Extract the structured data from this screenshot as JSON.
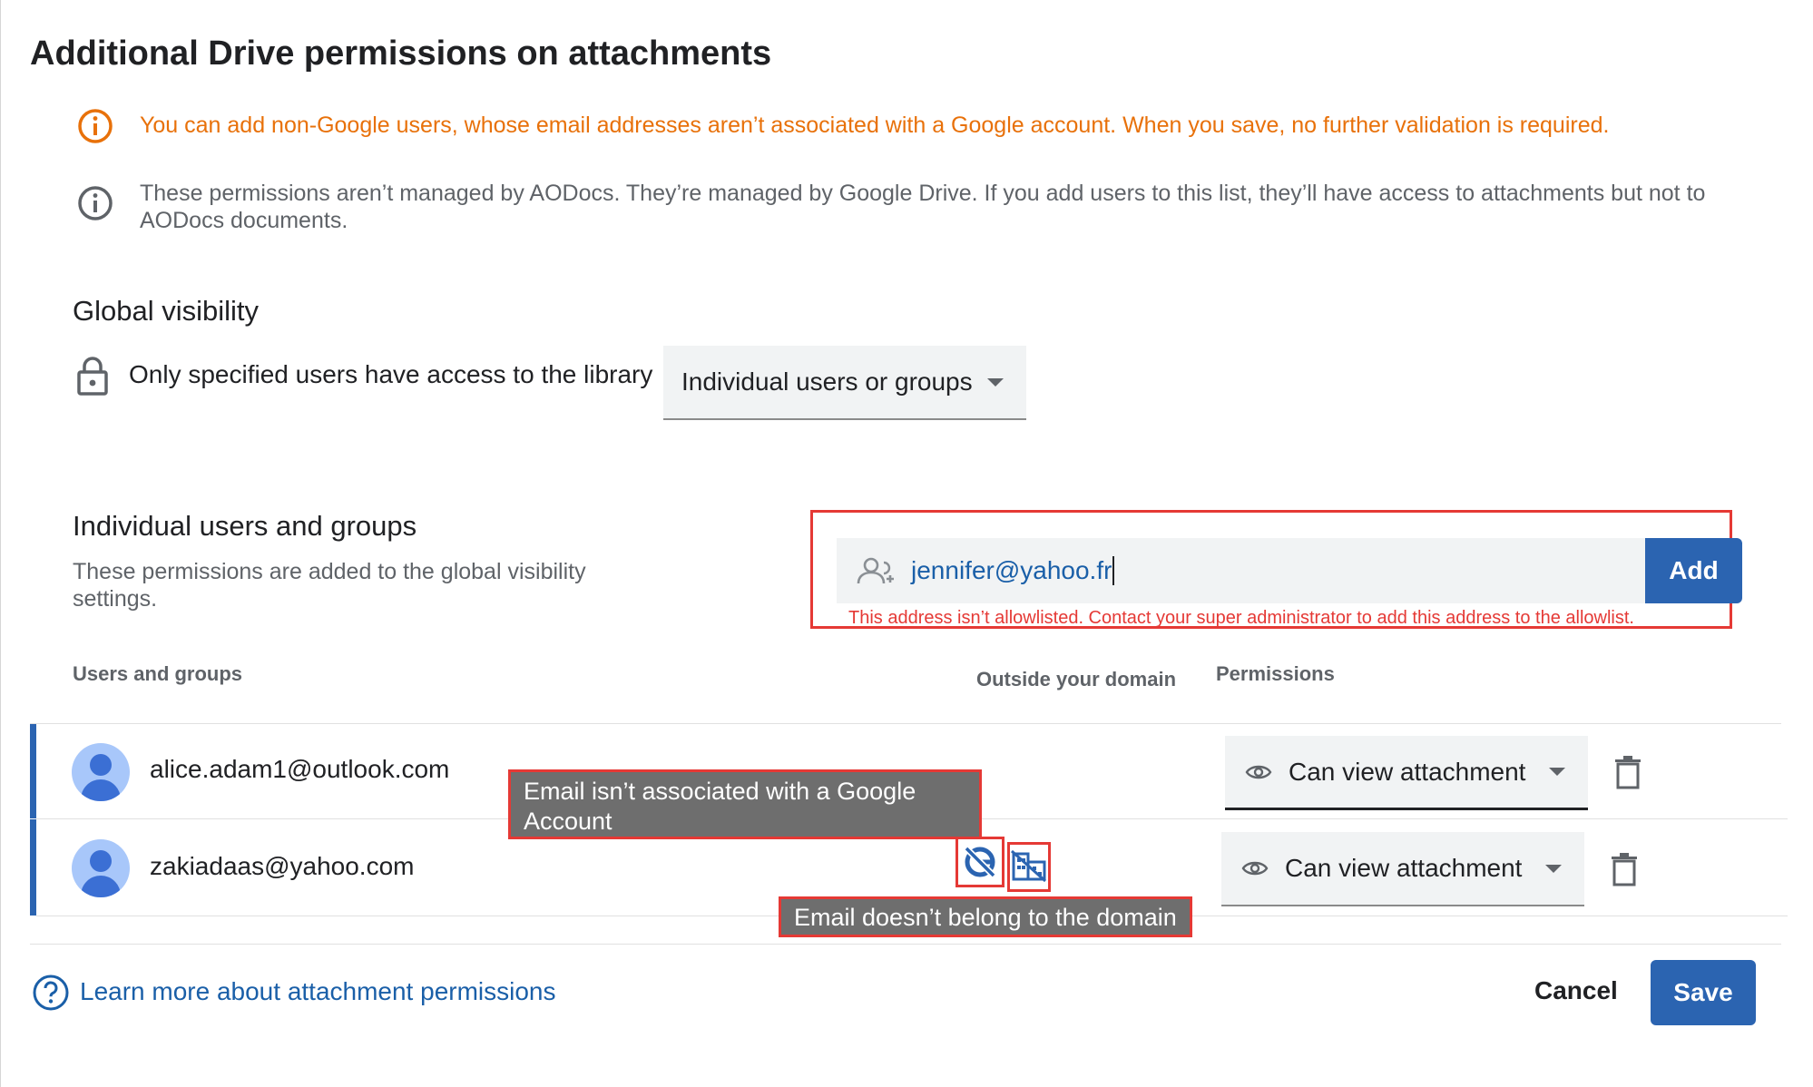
{
  "dialog": {
    "title": "Additional Drive permissions on attachments"
  },
  "notices": {
    "warning": "You can add non-Google users, whose email addresses aren’t associated with a Google account. When you save, no further validation is required.",
    "info": "These permissions aren’t managed by AODocs. They’re managed by Google Drive. If you add users to this list, they’ll have access to attachments but not to AODocs documents."
  },
  "global_visibility": {
    "heading": "Global visibility",
    "description": "Only specified users have access to the library",
    "selected": "Individual users or groups"
  },
  "individual": {
    "heading": "Individual users and groups",
    "description": "These permissions are added to the global visibility settings.",
    "input_value": "jennifer@yahoo.fr",
    "add_label": "Add",
    "error": "This address isn’t allowlisted. Contact your super administrator to add this address to the allowlist."
  },
  "table": {
    "columns": {
      "users": "Users and groups",
      "outside": "Outside your domain",
      "permissions": "Permissions"
    },
    "rows": [
      {
        "email": "alice.adam1@outlook.com",
        "permission": "Can view attachment"
      },
      {
        "email": "zakiadaas@yahoo.com",
        "permission": "Can view attachment"
      }
    ]
  },
  "tooltips": {
    "no_google": "Email isn’t associated with a Google Account",
    "outside_domain": "Email doesn’t belong to the domain"
  },
  "footer": {
    "learn_more": "Learn more about attachment permissions",
    "cancel": "Cancel",
    "save": "Save"
  },
  "colors": {
    "accent": "#2b64b1",
    "warning": "#e8710a",
    "error": "#e53935",
    "link": "#1a5fa8"
  },
  "icons": [
    "warning-info-icon",
    "info-icon",
    "lock-icon",
    "add-person-icon",
    "eye-icon",
    "trash-icon",
    "no-google-icon",
    "no-domain-icon",
    "help-icon"
  ]
}
